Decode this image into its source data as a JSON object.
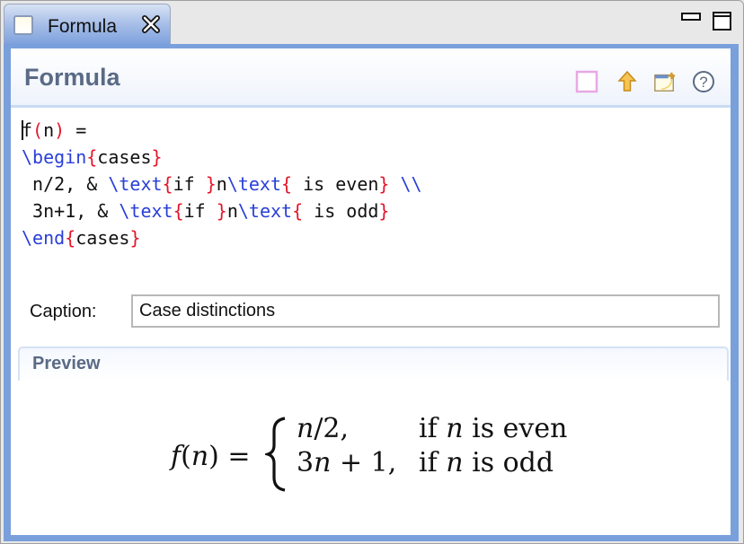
{
  "window": {
    "tab_label": "Formula",
    "tab_icon": "view-icon",
    "tab_close_icon": "close-icon",
    "minimize_icon": "minimize-icon",
    "maximize_icon": "maximize-icon"
  },
  "header": {
    "title": "Formula",
    "actions": [
      {
        "icon": "pink-square-icon"
      },
      {
        "icon": "arrow-up-icon"
      },
      {
        "icon": "new-window-icon"
      },
      {
        "icon": "help-icon"
      }
    ]
  },
  "editor": {
    "lines": [
      [
        {
          "t": "f"
        },
        {
          "t": "(",
          "c": "br"
        },
        {
          "t": "n"
        },
        {
          "t": ")",
          "c": "br"
        },
        {
          "t": " ="
        }
      ],
      [
        {
          "t": "\\begin",
          "c": "kw"
        },
        {
          "t": "{",
          "c": "br"
        },
        {
          "t": "cases"
        },
        {
          "t": "}",
          "c": "br"
        }
      ],
      [
        {
          "t": " n/2, & "
        },
        {
          "t": "\\text",
          "c": "kw"
        },
        {
          "t": "{",
          "c": "br"
        },
        {
          "t": "if "
        },
        {
          "t": "}",
          "c": "br"
        },
        {
          "t": "n"
        },
        {
          "t": "\\text",
          "c": "kw"
        },
        {
          "t": "{",
          "c": "br"
        },
        {
          "t": " is even"
        },
        {
          "t": "}",
          "c": "br"
        },
        {
          "t": " "
        },
        {
          "t": "\\\\",
          "c": "kw"
        }
      ],
      [
        {
          "t": " 3n+1, & "
        },
        {
          "t": "\\text",
          "c": "kw"
        },
        {
          "t": "{",
          "c": "br"
        },
        {
          "t": "if "
        },
        {
          "t": "}",
          "c": "br"
        },
        {
          "t": "n"
        },
        {
          "t": "\\text",
          "c": "kw"
        },
        {
          "t": "{",
          "c": "br"
        },
        {
          "t": " is odd"
        },
        {
          "t": "}",
          "c": "br"
        }
      ],
      [
        {
          "t": "\\end",
          "c": "kw"
        },
        {
          "t": "{",
          "c": "br"
        },
        {
          "t": "cases"
        },
        {
          "t": "}",
          "c": "br"
        }
      ]
    ]
  },
  "caption": {
    "label": "Caption:",
    "value": "Case distinctions"
  },
  "preview": {
    "title": "Preview",
    "formula": {
      "lhs_f": "f",
      "lhs_open": "(",
      "lhs_n": "n",
      "lhs_close": ") =",
      "row1_expr_n": "n",
      "row1_expr_rest": "/2,",
      "row1_cond_if": "if ",
      "row1_cond_n": "n",
      "row1_cond_rest": " is even",
      "row2_expr_3": "3",
      "row2_expr_n": "n",
      "row2_expr_rest": " + 1,",
      "row2_cond_if": "if ",
      "row2_cond_n": "n",
      "row2_cond_rest": " is odd"
    }
  },
  "colors": {
    "keyword": "#2a3fd8",
    "bracket": "#e3162a",
    "frame": "#7aa0dc",
    "header_text": "#5a6a86"
  }
}
